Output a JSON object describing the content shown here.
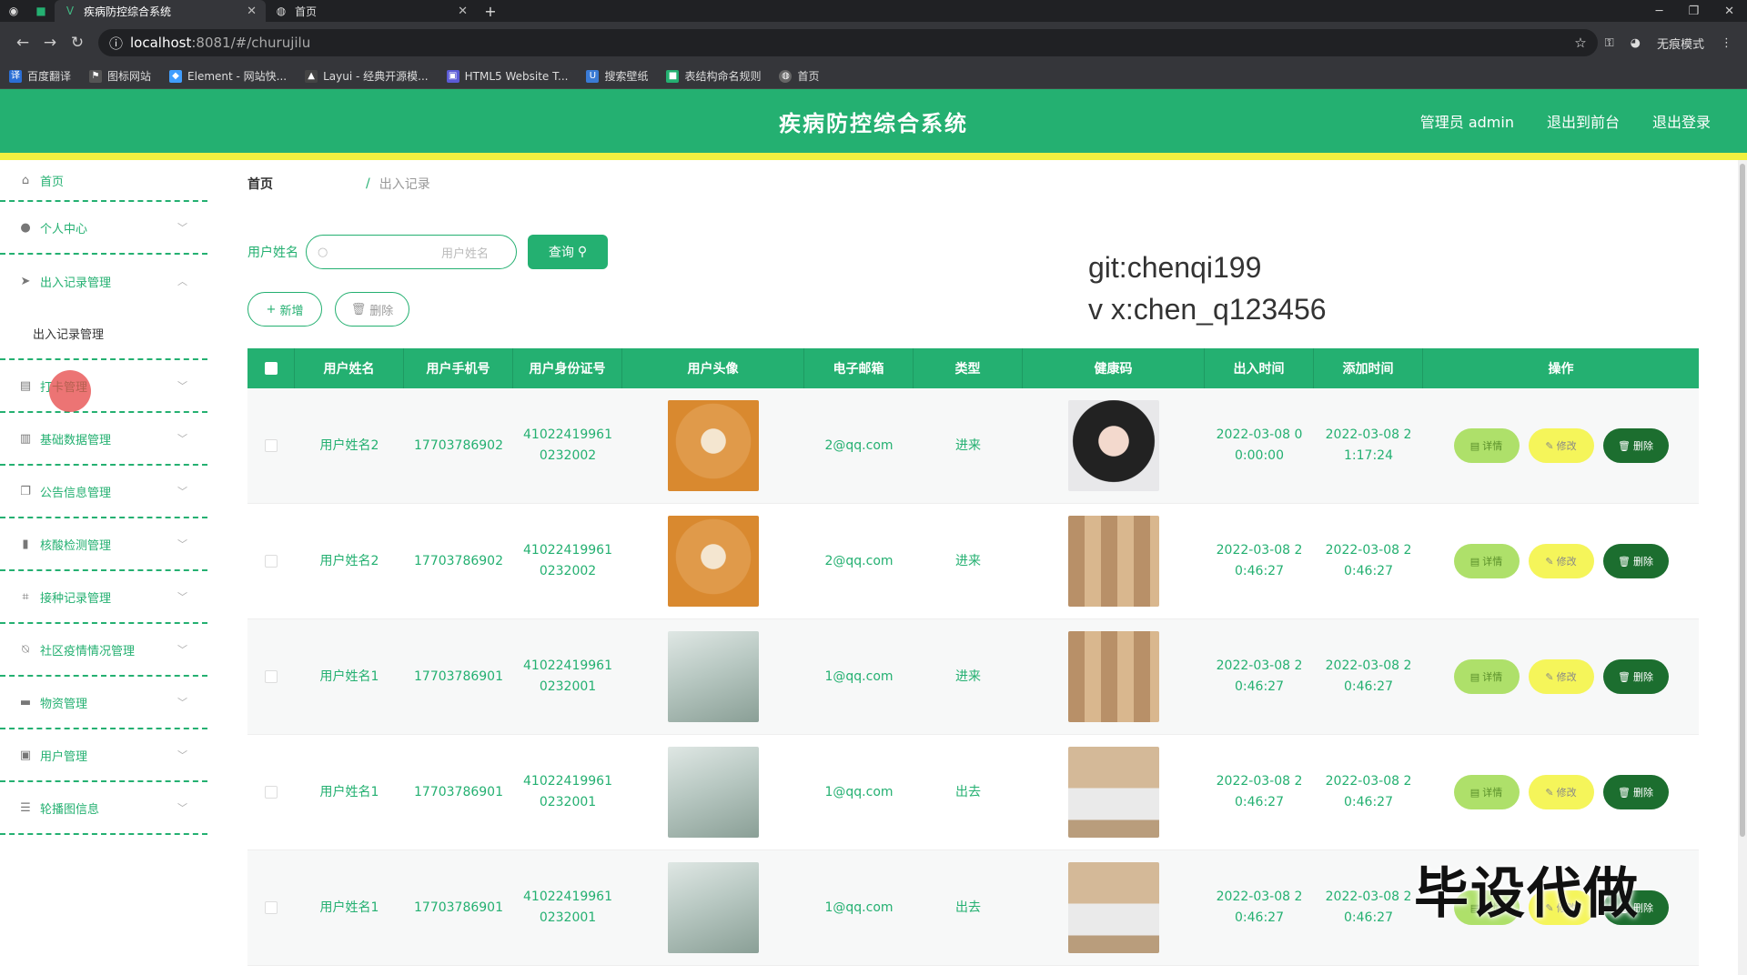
{
  "browser": {
    "tabs": [
      {
        "label": "疾病防控综合系统",
        "active": true
      },
      {
        "label": "首页",
        "active": false
      }
    ],
    "url_host": "localhost",
    "url_path": ":8081/#/churujilu",
    "incognito_label": "无痕模式",
    "bookmarks": [
      "百度翻译",
      "图标网站",
      "Element - 网站快...",
      "Layui - 经典开源模...",
      "HTML5 Website T...",
      "搜索壁纸",
      "表结构命名规则",
      "首页"
    ]
  },
  "header": {
    "title": "疾病防控综合系统",
    "admin": "管理员 admin",
    "to_front": "退出到前台",
    "logout": "退出登录"
  },
  "sidebar": {
    "items": [
      {
        "label": "首页",
        "icon": "home-icon"
      },
      {
        "label": "个人中心",
        "icon": "user-icon"
      },
      {
        "label": "出入记录管理",
        "icon": "send-icon"
      },
      {
        "label": "出入记录管理",
        "sub": true
      },
      {
        "label": "打卡管理",
        "icon": "clock-icon"
      },
      {
        "label": "基础数据管理",
        "icon": "db-icon"
      },
      {
        "label": "公告信息管理",
        "icon": "notice-icon"
      },
      {
        "label": "核酸检测管理",
        "icon": "chart-icon"
      },
      {
        "label": "接种记录管理",
        "icon": "crop-icon"
      },
      {
        "label": "社区疫情情况管理",
        "icon": "bell-icon"
      },
      {
        "label": "物资管理",
        "icon": "box-icon"
      },
      {
        "label": "用户管理",
        "icon": "users-icon"
      },
      {
        "label": "轮播图信息",
        "icon": "slider-icon"
      }
    ]
  },
  "breadcrumb": {
    "home": "首页",
    "sep": "/",
    "current": "出入记录"
  },
  "search": {
    "label": "用户姓名",
    "placeholder": "用户姓名",
    "button": "查询"
  },
  "toolbar": {
    "add": "新增",
    "delete": "删除"
  },
  "watermark_top": [
    "git:chenqi199",
    "v x:chen_q123456"
  ],
  "watermark_bottom": "毕设代做",
  "table": {
    "columns": [
      "用户姓名",
      "用户手机号",
      "用户身份证号",
      "用户头像",
      "电子邮箱",
      "类型",
      "健康码",
      "出入时间",
      "添加时间",
      "操作"
    ],
    "rows": [
      {
        "name": "用户姓名2",
        "phone": "17703786902",
        "id1": "41022419961",
        "id2": "0232002",
        "avatar": "shiba",
        "email": "2@qq.com",
        "type": "进来",
        "health": "girl2",
        "t1a": "2022-03-08 0",
        "t1b": "0:00:00",
        "t2a": "2022-03-08 2",
        "t2b": "1:17:24"
      },
      {
        "name": "用户姓名2",
        "phone": "17703786902",
        "id1": "41022419961",
        "id2": "0232002",
        "avatar": "shiba",
        "email": "2@qq.com",
        "type": "进来",
        "health": "boxes",
        "t1a": "2022-03-08 2",
        "t1b": "0:46:27",
        "t2a": "2022-03-08 2",
        "t2b": "0:46:27"
      },
      {
        "name": "用户姓名1",
        "phone": "17703786901",
        "id1": "41022419961",
        "id2": "0232001",
        "avatar": "girl",
        "email": "1@qq.com",
        "type": "进来",
        "health": "boxes",
        "t1a": "2022-03-08 2",
        "t1b": "0:46:27",
        "t2a": "2022-03-08 2",
        "t2b": "0:46:27"
      },
      {
        "name": "用户姓名1",
        "phone": "17703786901",
        "id1": "41022419961",
        "id2": "0232001",
        "avatar": "girl",
        "email": "1@qq.com",
        "type": "出去",
        "health": "ppe",
        "t1a": "2022-03-08 2",
        "t1b": "0:46:27",
        "t2a": "2022-03-08 2",
        "t2b": "0:46:27"
      },
      {
        "name": "用户姓名1",
        "phone": "17703786901",
        "id1": "41022419961",
        "id2": "0232001",
        "avatar": "girl",
        "email": "1@qq.com",
        "type": "出去",
        "health": "ppe",
        "t1a": "2022-03-08 2",
        "t1b": "0:46:27",
        "t2a": "2022-03-08 2",
        "t2b": "0:46:27"
      }
    ],
    "op_labels": {
      "detail": "详情",
      "edit": "修改",
      "del": "删除"
    }
  }
}
